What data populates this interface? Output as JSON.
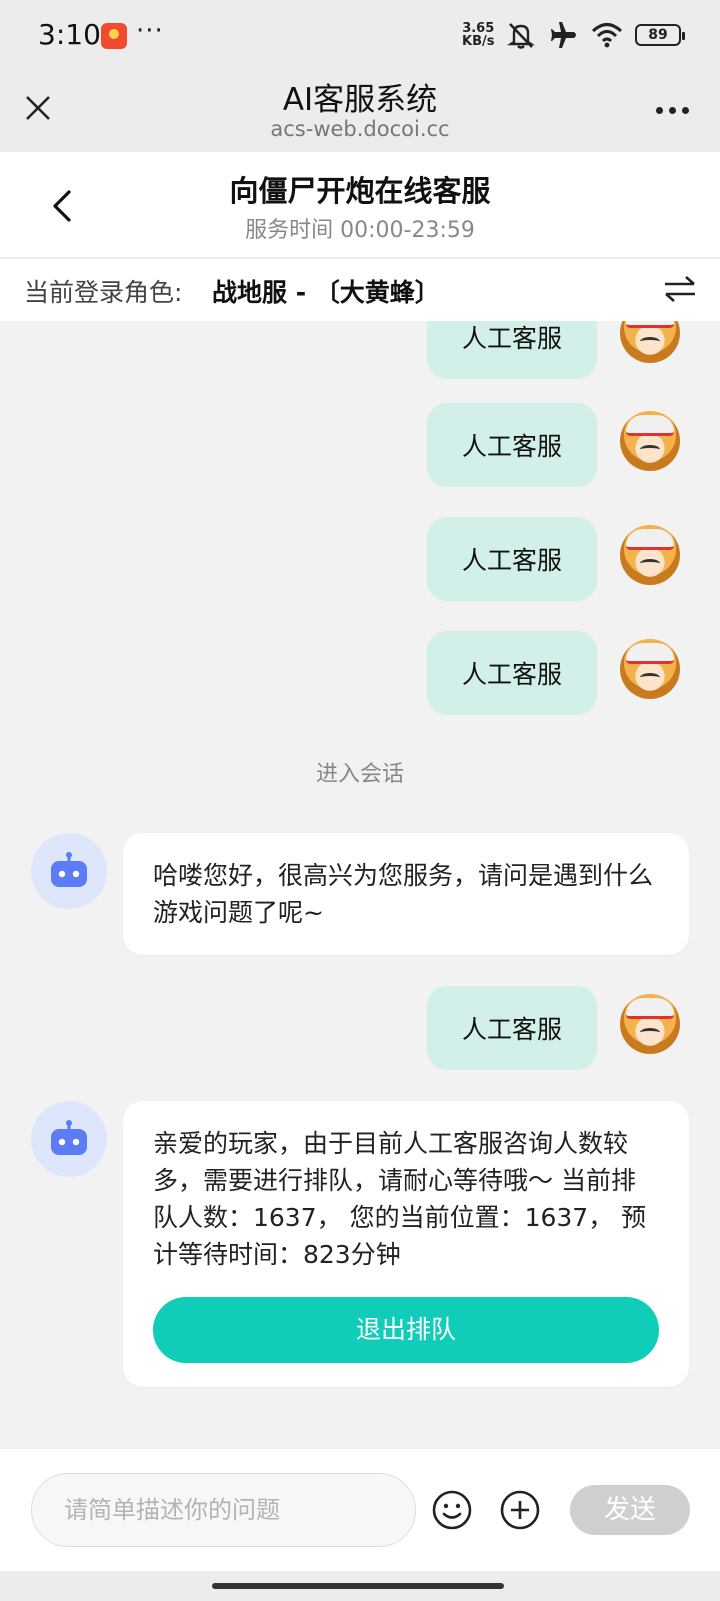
{
  "status_bar": {
    "time": "3:10",
    "dots": "···",
    "net_speed_value": "3.65",
    "net_speed_unit": "KB/s",
    "battery": "89"
  },
  "browser": {
    "title": "AI客服系统",
    "url": "acs-web.docoi.cc"
  },
  "header": {
    "title": "向僵尸开炮在线客服",
    "service_time": "服务时间 00:00-23:59"
  },
  "role": {
    "label": "当前登录角色:",
    "value": "战地服 - 〔大黄蜂〕"
  },
  "chat": {
    "user_messages": [
      "人工客服",
      "人工客服",
      "人工客服",
      "人工客服",
      "人工客服"
    ],
    "session_note": "进入会话",
    "bot_greeting": "哈喽您好，很高兴为您服务，请问是遇到什么游戏问题了呢~",
    "bot_queue_message": "亲爱的玩家，由于目前人工客服咨询人数较多，需要进行排队，请耐心等待哦～ 当前排队人数：1637， 您的当前位置：1637， 预计等待时间：823分钟",
    "exit_queue_label": "退出排队"
  },
  "input": {
    "placeholder": "请简单描述你的问题",
    "send_label": "发送"
  },
  "colors": {
    "accent": "#0fcdb8",
    "user_bubble": "#d3efea",
    "bot_avatar_bg": "#dde6fb",
    "bot_icon": "#5b7cf5"
  }
}
